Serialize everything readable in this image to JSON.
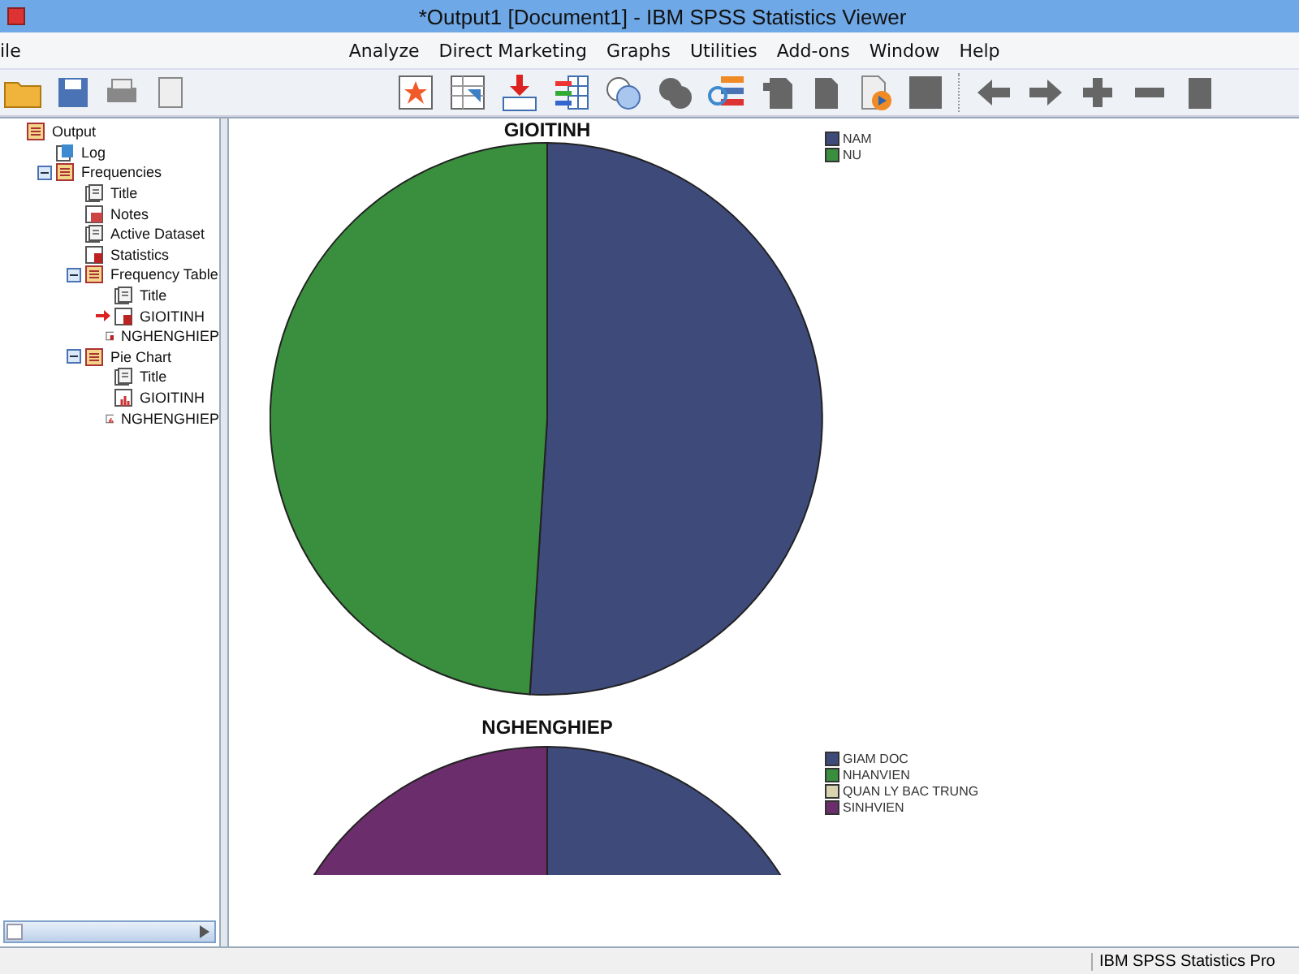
{
  "window": {
    "title": "*Output1 [Document1] - IBM SPSS Statistics Viewer"
  },
  "menu": [
    "ile",
    "Analyze",
    "Direct Marketing",
    "Graphs",
    "Utilities",
    "Add-ons",
    "Window",
    "Help"
  ],
  "outline": [
    {
      "label": "Output",
      "kind": "book",
      "current": false,
      "children": [
        {
          "label": "Log",
          "kind": "log",
          "current": false
        },
        {
          "label": "Frequencies",
          "kind": "book",
          "current": false,
          "expanded": true,
          "children": [
            {
              "label": "Title",
              "kind": "title",
              "current": false
            },
            {
              "label": "Notes",
              "kind": "notes",
              "current": false
            },
            {
              "label": "Active Dataset",
              "kind": "title",
              "current": false
            },
            {
              "label": "Statistics",
              "kind": "table",
              "current": false
            },
            {
              "label": "Frequency Table",
              "kind": "book",
              "current": false,
              "expanded": true,
              "children": [
                {
                  "label": "Title",
                  "kind": "title",
                  "current": false
                },
                {
                  "label": "GIOITINH",
                  "kind": "table",
                  "current": true
                },
                {
                  "label": "NGHENGHIEP",
                  "kind": "table",
                  "current": false
                }
              ]
            },
            {
              "label": "Pie Chart",
              "kind": "book",
              "current": false,
              "expanded": true,
              "children": [
                {
                  "label": "Title",
                  "kind": "title",
                  "current": false
                },
                {
                  "label": "GIOITINH",
                  "kind": "chart",
                  "current": false
                },
                {
                  "label": "NGHENGHIEP",
                  "kind": "chart",
                  "current": false
                }
              ]
            }
          ]
        }
      ]
    }
  ],
  "charts": [
    {
      "title": "GIOITINH",
      "legend": [
        {
          "label": "NAM",
          "color": "#3e4a7a"
        },
        {
          "label": "NU",
          "color": "#3a8f3e"
        }
      ]
    },
    {
      "title": "NGHENGHIEP",
      "legend": [
        {
          "label": "GIAM DOC",
          "color": "#3e4a7a"
        },
        {
          "label": "NHANVIEN",
          "color": "#3a8f3e"
        },
        {
          "label": "QUAN LY BAC TRUNG",
          "color": "#d8d4b0"
        },
        {
          "label": "SINHVIEN",
          "color": "#6b2d6b"
        }
      ]
    }
  ],
  "status_bar": {
    "text": "IBM SPSS Statistics Pro"
  }
}
